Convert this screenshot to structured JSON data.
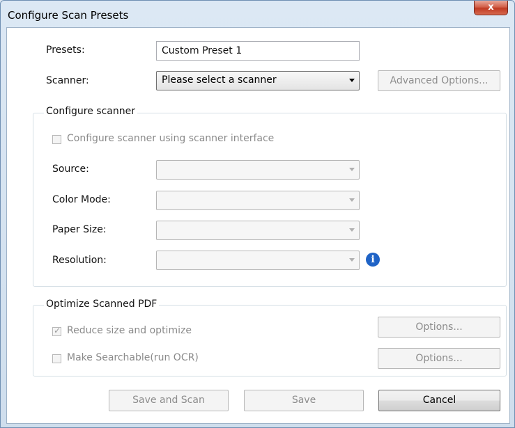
{
  "window": {
    "title": "Configure Scan Presets",
    "close_glyph": "x"
  },
  "presets": {
    "label": "Presets:",
    "value": "Custom Preset 1"
  },
  "scanner": {
    "label": "Scanner:",
    "value": "Please select a scanner",
    "advanced_button": "Advanced Options..."
  },
  "configure_group": {
    "title": "Configure scanner",
    "use_interface_label": "Configure scanner using scanner interface",
    "use_interface_checked": false,
    "source_label": "Source:",
    "color_mode_label": "Color Mode:",
    "paper_size_label": "Paper Size:",
    "resolution_label": "Resolution:",
    "info_glyph": "i"
  },
  "optimize_group": {
    "title": "Optimize Scanned PDF",
    "reduce_label": "Reduce size and optimize",
    "reduce_checked": true,
    "ocr_label": "Make Searchable(run OCR)",
    "ocr_checked": false,
    "options_label": "Options..."
  },
  "footer": {
    "save_and_scan": "Save and Scan",
    "save": "Save",
    "cancel": "Cancel"
  },
  "icons": {
    "close": "close-icon",
    "dropdown": "chevron-down-icon",
    "info": "info-icon"
  }
}
